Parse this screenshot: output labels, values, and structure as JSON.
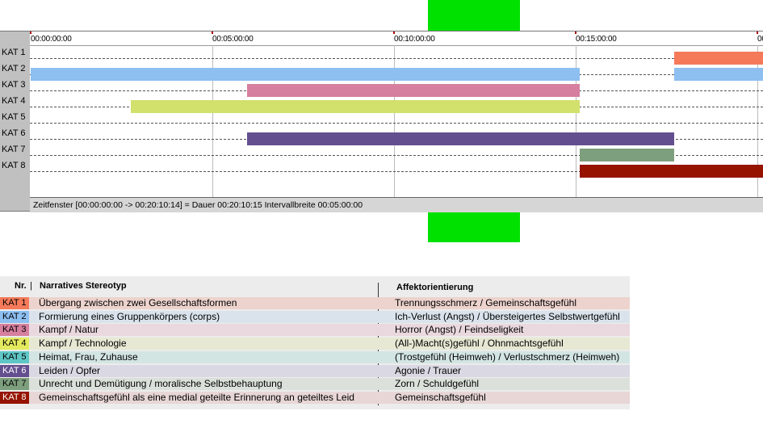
{
  "timeline": {
    "ticks": [
      "00:00:00:00",
      "00:05:00:00",
      "00:10:00:00",
      "00:15:00:00",
      "00"
    ],
    "row_labels": [
      "KAT 1",
      "KAT 2",
      "KAT 3",
      "KAT 4",
      "KAT 5",
      "KAT 6",
      "KAT 7",
      "KAT 8"
    ],
    "status": "Zeitfenster [00:00:00:00 -> 00:20:10:14] = Dauer 00:20:10:15    Intervallbreite 00:05:00:00",
    "time_axis_minutes": [
      0,
      20.17
    ],
    "bars": [
      {
        "row": 0,
        "start_min": 17.7,
        "end_min": 20.17,
        "color": "#f47a5a"
      },
      {
        "row": 1,
        "start_min": 0.0,
        "end_min": 15.1,
        "color": "#8dbff0"
      },
      {
        "row": 1,
        "start_min": 17.7,
        "end_min": 20.17,
        "color": "#8dbff0"
      },
      {
        "row": 2,
        "start_min": 5.95,
        "end_min": 15.1,
        "color": "#d67f9f"
      },
      {
        "row": 3,
        "start_min": 2.75,
        "end_min": 15.1,
        "color": "#d2e06c"
      },
      {
        "row": 5,
        "start_min": 5.95,
        "end_min": 17.7,
        "color": "#634f8f"
      },
      {
        "row": 6,
        "start_min": 15.1,
        "end_min": 17.7,
        "color": "#7e9f7d"
      },
      {
        "row": 7,
        "start_min": 15.1,
        "end_min": 20.17,
        "color": "#961300"
      }
    ]
  },
  "legend": {
    "header_nr": "Nr.",
    "header_stereotyp": "Narratives Stereotyp",
    "header_affekt": "Affektorientierung",
    "rows": [
      {
        "kat": "KAT 1",
        "stereotyp": "Übergang zwischen zwei Gesellschaftsformen",
        "affekt": "Trennungsschmerz / Gemeinschaftsgefühl",
        "tag_color": "#f47a5a",
        "row_color": "#edd3cd",
        "tag_text": "#000000"
      },
      {
        "kat": "KAT 2",
        "stereotyp": "Formierung eines Gruppenkörpers (corps)",
        "affekt": "Ich-Verlust (Angst) / Übersteigertes Selbstwertgefühl",
        "tag_color": "#8dbff0",
        "row_color": "#dae3ec",
        "tag_text": "#000000"
      },
      {
        "kat": "KAT 3",
        "stereotyp": "Kampf / Natur",
        "affekt": "Horror (Angst) / Feindseligkeit",
        "tag_color": "#d67f9f",
        "row_color": "#ead8df",
        "tag_text": "#000000"
      },
      {
        "kat": "KAT 4",
        "stereotyp": "Kampf / Technologie",
        "affekt": "(All-)Macht(s)gefühl / Ohnmachtsgefühl",
        "tag_color": "#e4ea5e",
        "row_color": "#e7e8d3",
        "tag_text": "#000000"
      },
      {
        "kat": "KAT 5",
        "stereotyp": "Heimat, Frau, Zuhause",
        "affekt": "(Trostgefühl (Heimweh) / Verlustschmerz (Heimweh)",
        "tag_color": "#5fc6c6",
        "row_color": "#d3e5e3",
        "tag_text": "#000000"
      },
      {
        "kat": "KAT 6",
        "stereotyp": "Leiden / Opfer",
        "affekt": "Agonie / Trauer",
        "tag_color": "#634f8f",
        "row_color": "#dad8e2",
        "tag_text": "#ffffff"
      },
      {
        "kat": "KAT 7",
        "stereotyp": "Unrecht und Demütigung / moralische Selbstbehauptung",
        "affekt": "Zorn / Schuldgefühl",
        "tag_color": "#7e9f7d",
        "row_color": "#dbe1da",
        "tag_text": "#000000"
      },
      {
        "kat": "KAT 8",
        "stereotyp": "Gemeinschaftsgefühl als eine medial geteilte Erinnerung an geteiltes Leid",
        "affekt": "Gemeinschaftsgefühl",
        "tag_color": "#961300",
        "row_color": "#e8d6d6",
        "tag_text": "#ffffff"
      }
    ]
  },
  "colors": {
    "marker_green": "#00e100"
  }
}
